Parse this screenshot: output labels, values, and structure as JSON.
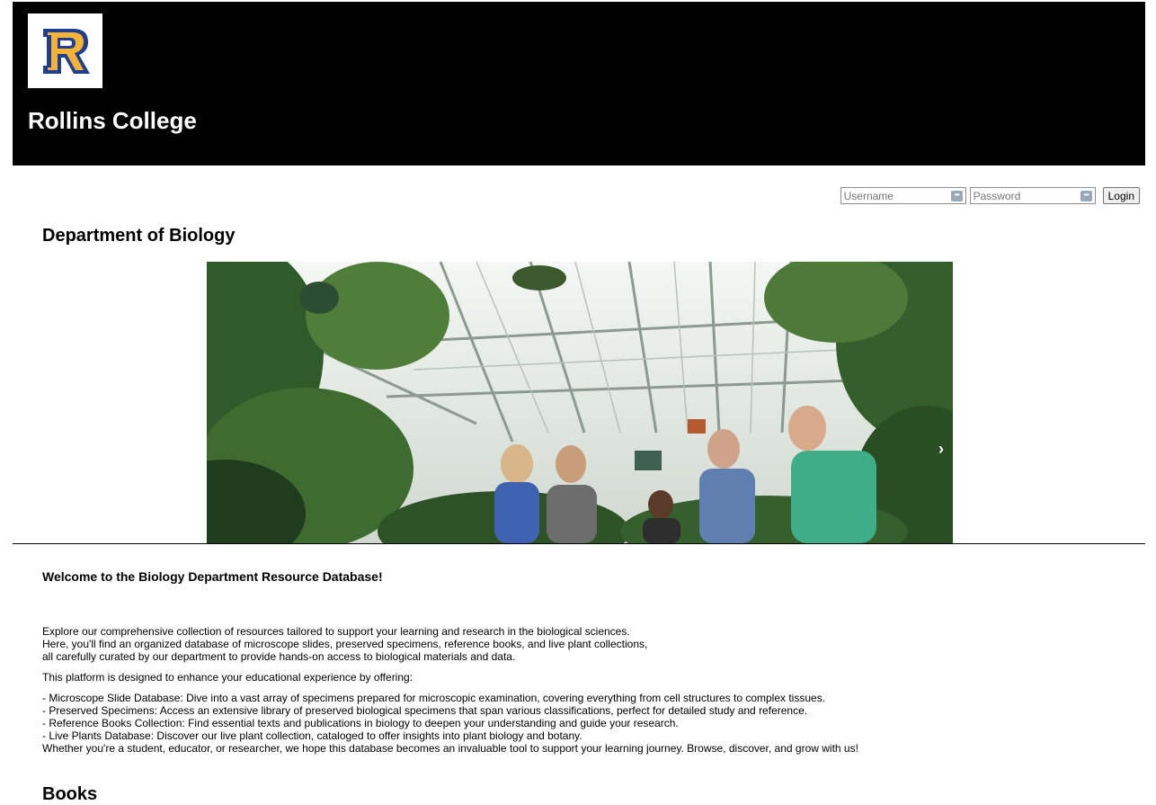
{
  "header": {
    "logo_letter": "R",
    "site_title": "Rollins College"
  },
  "login": {
    "username_placeholder": "Username",
    "password_placeholder": "Password",
    "login_label": "Login"
  },
  "department": {
    "title": "Department of Biology"
  },
  "hero": {
    "next_arrow": "›"
  },
  "welcome": {
    "heading": "Welcome to the Biology Department Resource Database!",
    "intro_lines": [
      "Explore our comprehensive collection of resources tailored to support your learning and research in the biological sciences.",
      "Here, you'll find an organized database of microscope slides, preserved specimens, reference books, and live plant collections,",
      "all carefully curated by our department to provide hands-on access to biological materials and data."
    ],
    "platform_line": "This platform is designed to enhance your educational experience by offering:",
    "features": [
      "- Microscope Slide Database: Dive into a vast array of specimens prepared for microscopic examination, covering everything from cell structures to complex tissues.",
      "- Preserved Specimens: Access an extensive library of preserved biological specimens that span various classifications, perfect for detailed study and reference.",
      "- Reference Books Collection: Find essential texts and publications in biology to deepen your understanding and guide your research.",
      "- Live Plants Database: Discover our live plant collection, cataloged to offer insights into plant biology and botany."
    ],
    "closing": "Whether you're a student, educator, or researcher, we hope this database becomes an invaluable tool to support your learning journey. Browse, discover, and grow with us!"
  },
  "next_section": {
    "heading": "Books"
  },
  "colors": {
    "header_bg": "#000000",
    "logo_blue": "#1e3f8f",
    "logo_gold": "#f5b335"
  }
}
